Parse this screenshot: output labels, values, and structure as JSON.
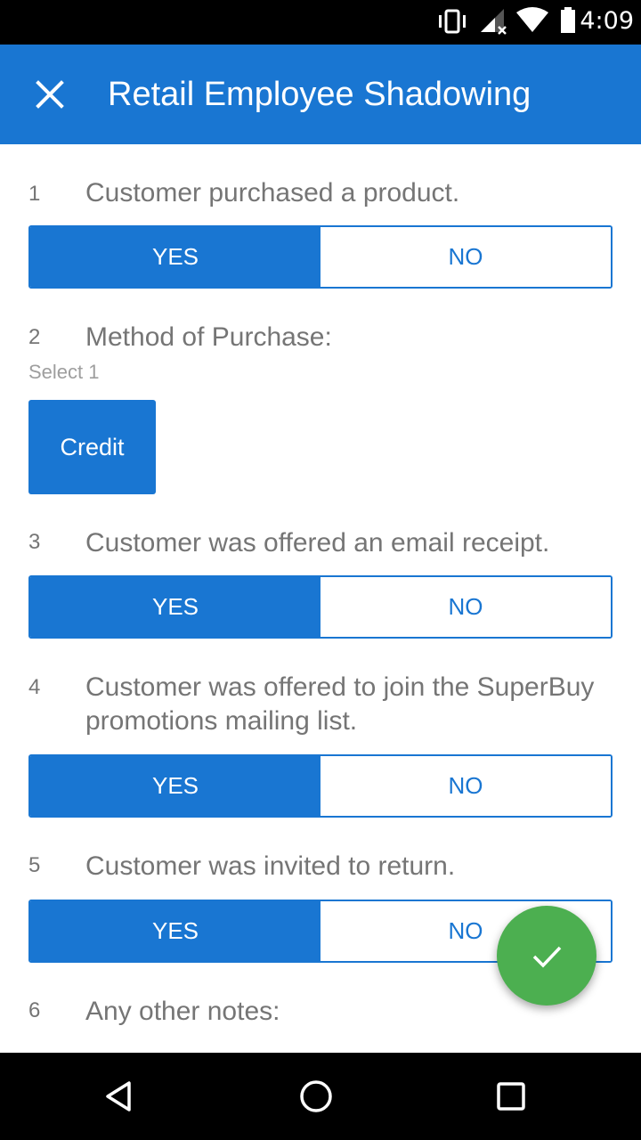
{
  "status_bar": {
    "time": "4:09",
    "icons": [
      "vibrate-icon",
      "signal-icon",
      "wifi-icon",
      "battery-icon"
    ]
  },
  "app_bar": {
    "title": "Retail Employee Shadowing",
    "close_icon": "close-icon"
  },
  "questions": [
    {
      "number": "1",
      "text": "Customer purchased a product.",
      "type": "yes_no",
      "yes_label": "YES",
      "no_label": "NO",
      "selected": "YES"
    },
    {
      "number": "2",
      "text": "Method of Purchase:",
      "hint": "Select 1",
      "type": "choice",
      "options": [
        "Credit"
      ],
      "selected": "Credit"
    },
    {
      "number": "3",
      "text": "Customer was offered an email receipt.",
      "type": "yes_no",
      "yes_label": "YES",
      "no_label": "NO",
      "selected": "YES"
    },
    {
      "number": "4",
      "text": "Customer was offered to join the SuperBuy promotions mailing list.",
      "type": "yes_no",
      "yes_label": "YES",
      "no_label": "NO",
      "selected": "YES"
    },
    {
      "number": "5",
      "text": "Customer was invited to return.",
      "type": "yes_no",
      "yes_label": "YES",
      "no_label": "NO",
      "selected": "YES"
    },
    {
      "number": "6",
      "text": "Any other notes:",
      "type": "text"
    }
  ],
  "fab": {
    "icon": "checkmark-icon"
  },
  "nav_bar": {
    "icons": [
      "back-icon",
      "home-icon",
      "recents-icon"
    ]
  },
  "colors": {
    "primary": "#1976d2",
    "fab": "#4caf50",
    "question_text": "#757575",
    "hint": "#9e9e9e"
  }
}
